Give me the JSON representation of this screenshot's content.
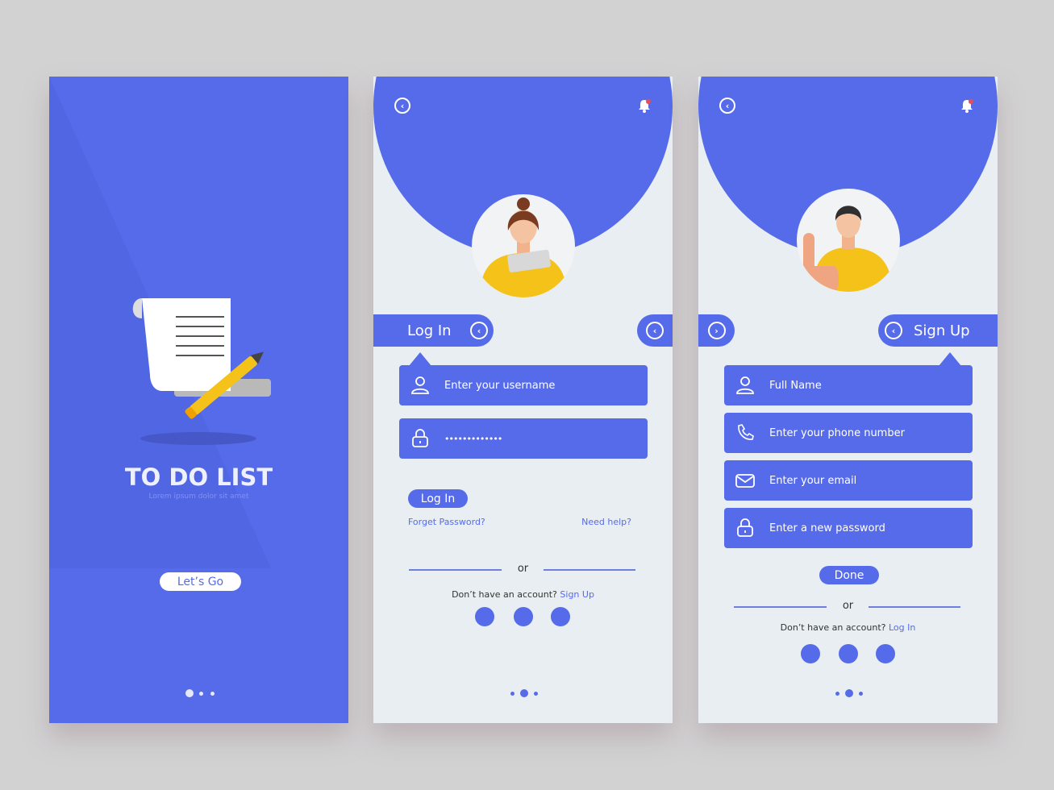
{
  "colors": {
    "accent": "#566bea",
    "panel_bg": "#e8eef1",
    "page_bg": "#d2d2d3"
  },
  "intro": {
    "title": "TO DO LIST",
    "subtitle": "Lorem ipsum dolor sit amet",
    "cta": "Let’s Go",
    "illustration": "scroll-and-pencil",
    "page_index": 1,
    "page_count": 3
  },
  "login": {
    "tab_label": "Log In",
    "username_placeholder": "Enter your username",
    "password_value": "•••••••••••••",
    "button": "Log In",
    "forgot": "Forget Password?",
    "help": "Need help?",
    "or": "or",
    "no_account": "Don’t have an account?",
    "signup_link": "Sign Up",
    "page_index": 2,
    "page_count": 3,
    "icons": [
      "back-icon",
      "bell-icon",
      "user-icon",
      "lock-icon"
    ]
  },
  "signup": {
    "tab_label": "Sign Up",
    "fields": [
      "Full Name",
      "Enter your phone number",
      "Enter your email",
      "Enter a new password"
    ],
    "button": "Done",
    "or": "or",
    "no_account": "Don’t have an account?",
    "login_link": "Log In",
    "page_index": 2,
    "page_count": 3,
    "icons": [
      "back-icon",
      "bell-icon",
      "user-icon",
      "phone-icon",
      "mail-icon",
      "lock-icon"
    ]
  }
}
